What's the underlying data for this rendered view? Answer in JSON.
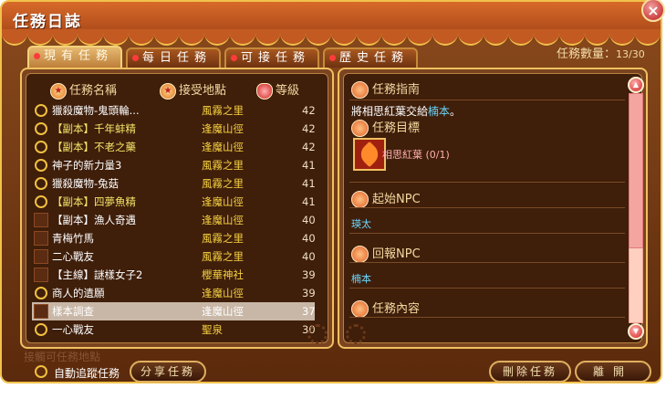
{
  "window": {
    "title": "任務日誌",
    "close_label": "×"
  },
  "quest_count": {
    "label": "任務數量：",
    "value": "13/30"
  },
  "tabs": [
    {
      "label": "現有任務",
      "active": true
    },
    {
      "label": "每日任務",
      "active": false
    },
    {
      "label": "可接任務",
      "active": false
    },
    {
      "label": "歷史任務",
      "active": false
    }
  ],
  "list": {
    "headers": {
      "name": "任務名稱",
      "location": "接受地點",
      "level": "等級"
    },
    "rows": [
      {
        "name": "獵殺魔物-鬼頭輪...",
        "location": "風霧之里",
        "level": "42",
        "mark": "circle",
        "color": "white"
      },
      {
        "name": "【副本】千年蚌精",
        "location": "逢魔山徑",
        "level": "42",
        "mark": "circle",
        "color": "yellow"
      },
      {
        "name": "【副本】不老之藥",
        "location": "逢魔山徑",
        "level": "42",
        "mark": "circle",
        "color": "yellow"
      },
      {
        "name": "神子的新力量3",
        "location": "風霧之里",
        "level": "41",
        "mark": "circle",
        "color": "white"
      },
      {
        "name": "獵殺魔物-兔菇",
        "location": "風霧之里",
        "level": "41",
        "mark": "circle",
        "color": "white"
      },
      {
        "name": "【副本】四夢魚精",
        "location": "逢魔山徑",
        "level": "41",
        "mark": "circle",
        "color": "yellow"
      },
      {
        "name": "【副本】漁人奇遇",
        "location": "逢魔山徑",
        "level": "40",
        "mark": "square",
        "color": "white"
      },
      {
        "name": "青梅竹馬",
        "location": "風霧之里",
        "level": "40",
        "mark": "square",
        "color": "white"
      },
      {
        "name": "二心戰友",
        "location": "風霧之里",
        "level": "40",
        "mark": "square",
        "color": "white"
      },
      {
        "name": "【主線】謎樣女子2",
        "location": "櫻華神社",
        "level": "39",
        "mark": "square",
        "color": "white"
      },
      {
        "name": "商人的遺願",
        "location": "逢魔山徑",
        "level": "39",
        "mark": "circle",
        "color": "white"
      },
      {
        "name": "樣本調查",
        "location": "逢魔山徑",
        "level": "37",
        "mark": "square",
        "color": "white",
        "selected": true
      },
      {
        "name": "一心戰友",
        "location": "聖泉",
        "level": "30",
        "mark": "circle",
        "color": "white"
      }
    ]
  },
  "guide": {
    "title": "任務指南",
    "summary_prefix": "將相思紅葉交給",
    "summary_npc": "楠本",
    "summary_suffix": "。",
    "objective_label": "任務目標",
    "objective_item": "相思紅葉 (0/1)",
    "start_npc_label": "起始NPC",
    "start_npc": "瑛太",
    "return_npc_label": "回報NPC",
    "return_npc": "楠本",
    "content_label": "任務內容"
  },
  "bottom": {
    "faded_text": "接觸可任務地點",
    "auto_track_label": "自動追蹤任務",
    "share_button": "分享任務",
    "delete_button": "刪除任務",
    "close_button": "離開"
  }
}
